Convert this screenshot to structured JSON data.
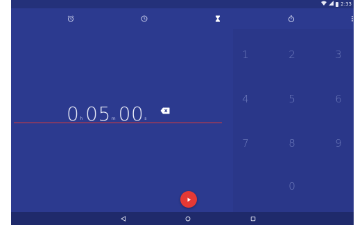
{
  "statusbar": {
    "wifi_icon": "wifi-icon",
    "signal_icon": "signal-icon",
    "battery_icon": "battery-icon",
    "time": "2:33"
  },
  "tabs": [
    {
      "name": "alarm",
      "icon": "alarm-icon"
    },
    {
      "name": "clock",
      "icon": "clock-icon"
    },
    {
      "name": "timer",
      "icon": "hourglass-icon",
      "active": true
    },
    {
      "name": "stopwatch",
      "icon": "stopwatch-icon"
    }
  ],
  "timer": {
    "hours": "0",
    "hours_unit": "h",
    "minutes": "05",
    "minutes_unit": "m",
    "seconds": "00",
    "seconds_unit": "s"
  },
  "keypad": [
    "1",
    "2",
    "3",
    "4",
    "5",
    "6",
    "7",
    "8",
    "9",
    "0"
  ],
  "colors": {
    "background": "#2c3a8f",
    "accent": "#e53935"
  }
}
